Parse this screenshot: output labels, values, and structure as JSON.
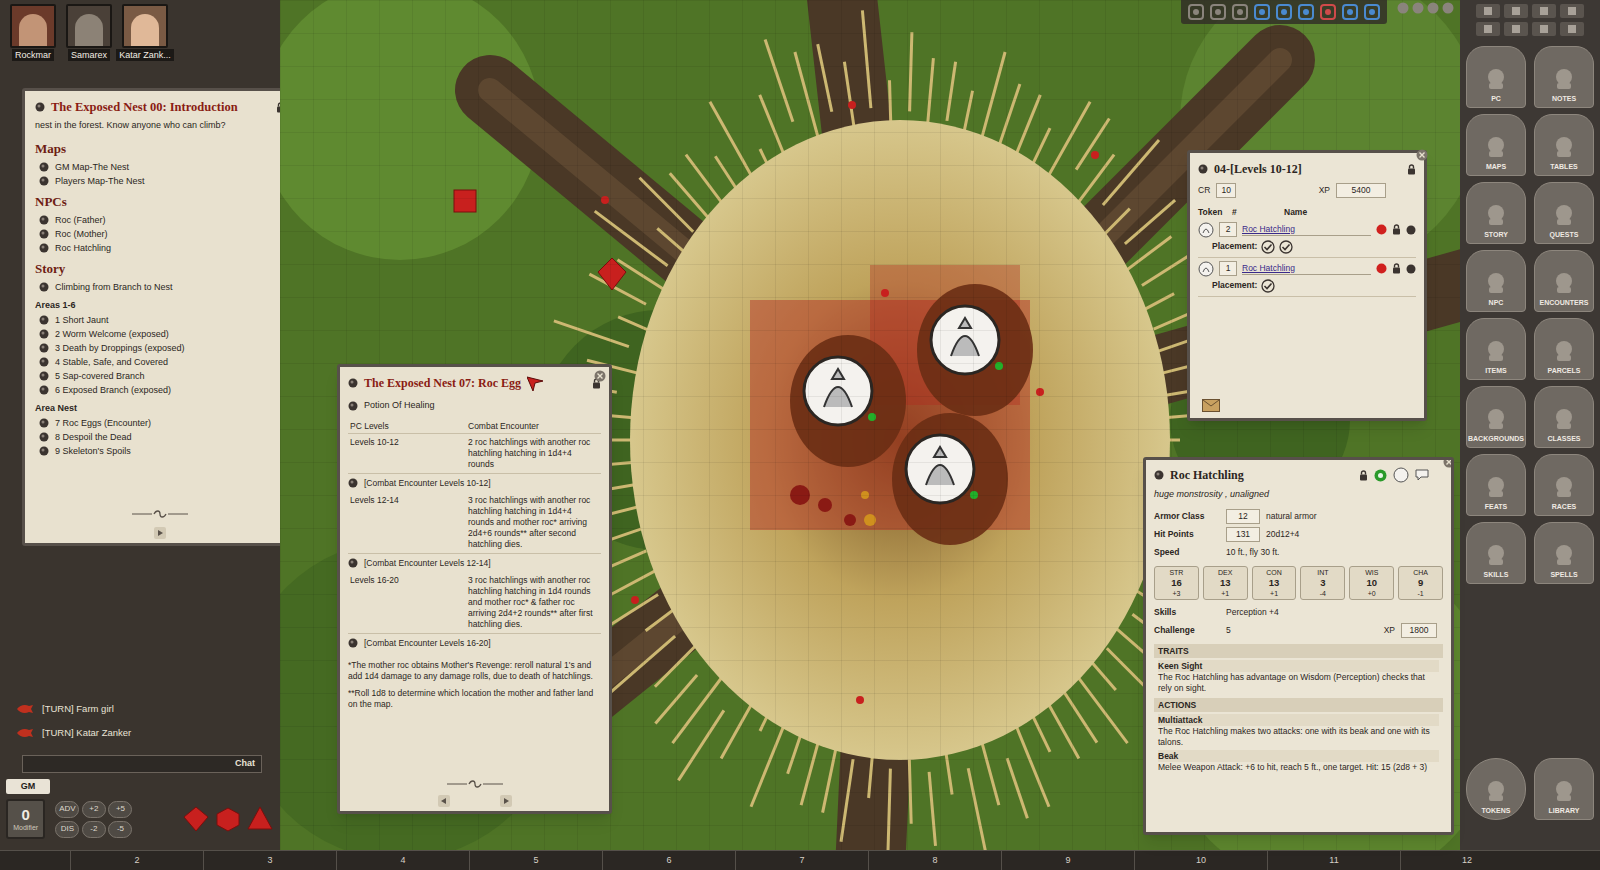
{
  "party": [
    {
      "name": "Rockmar"
    },
    {
      "name": "Samarex"
    },
    {
      "name": "Katar Zank..."
    }
  ],
  "story": {
    "title": "The Exposed Nest 00: Introduction",
    "intro": "nest in the forest. Know anyone who can climb?",
    "entries": [
      {
        "kind": "heading",
        "text": "Maps"
      },
      {
        "kind": "link",
        "text": "GM Map-The Nest"
      },
      {
        "kind": "link",
        "text": "Players Map-The Nest"
      },
      {
        "kind": "heading",
        "text": "NPCs"
      },
      {
        "kind": "link",
        "text": "Roc (Father)"
      },
      {
        "kind": "link",
        "text": "Roc (Mother)"
      },
      {
        "kind": "link",
        "text": "Roc Hatchling"
      },
      {
        "kind": "heading",
        "text": "Story"
      },
      {
        "kind": "link",
        "text": "Climbing from Branch to Nest"
      },
      {
        "kind": "subheading",
        "text": "Areas 1-6"
      },
      {
        "kind": "link",
        "text": "1 Short Jaunt"
      },
      {
        "kind": "link",
        "text": "2 Worm Welcome (exposed)"
      },
      {
        "kind": "link",
        "text": "3 Death by Droppings (exposed)"
      },
      {
        "kind": "link",
        "text": "4 Stable, Safe, and Covered"
      },
      {
        "kind": "link",
        "text": "5 Sap-covered Branch"
      },
      {
        "kind": "link",
        "text": "6 Exposed Branch (exposed)"
      },
      {
        "kind": "subheading",
        "text": "Area Nest"
      },
      {
        "kind": "link",
        "text": "7 Roc Eggs (Encounter)"
      },
      {
        "kind": "link",
        "text": "8 Despoil the Dead"
      },
      {
        "kind": "link",
        "text": "9 Skeleton's Spoils"
      }
    ]
  },
  "chat": {
    "messages": [
      {
        "text": "[TURN] Farm girl"
      },
      {
        "text": "[TURN] Katar Zanker"
      }
    ],
    "input_label": "Chat"
  },
  "identity": "GM",
  "modifier": {
    "value": "0",
    "label": "Modifier"
  },
  "modifier_buttons": [
    "ADV",
    "+2",
    "+5",
    "DIS",
    "-2",
    "-5"
  ],
  "notes": {
    "title": "The Exposed Nest 07: Roc Egg",
    "item": "Potion Of Healing",
    "columns": [
      "PC Levels",
      "Combat Encounter"
    ],
    "rows": [
      {
        "level": "Levels 10-12",
        "encounter": "2 roc hatchlings with another roc hatchling hatching in 1d4+4 rounds",
        "link": "[Combat Encounter Levels 10-12]"
      },
      {
        "level": "Levels 12-14",
        "encounter": "3 roc hatchlings with another roc hatchling hatching in 1d4+4 rounds and mother roc* arriving 2d4+6 rounds** after second hatchling dies.",
        "link": "[Combat Encounter Levels 12-14]"
      },
      {
        "level": "Levels 16-20",
        "encounter": "3 roc hatchlings with another roc hatchling hatching in 1d4 rounds and mother roc* & father roc arriving 2d4+2 rounds** after first hatchling dies.",
        "link": "[Combat Encounter Levels 16-20]"
      }
    ],
    "footnotes": [
      "*The mother roc obtains Mother's Revenge: reroll natural 1's and add 1d4 damage to any damage rolls, due to death of hatchlings.",
      "**Roll 1d8 to determine which location the mother and father land on the map."
    ]
  },
  "encounter": {
    "title": "04-[Levels 10-12]",
    "cr_label": "CR",
    "cr": "10",
    "xp_label": "XP",
    "xp": "5400",
    "columns": [
      "Token",
      "#",
      "Name"
    ],
    "rows": [
      {
        "count": "2",
        "name": "Roc Hatchling",
        "placement_label": "Placement:",
        "placements": [
          true,
          true
        ]
      },
      {
        "count": "1",
        "name": "Roc Hatchling",
        "placement_label": "Placement:",
        "placements": [
          true
        ]
      }
    ]
  },
  "npc": {
    "name": "Roc Hatchling",
    "type": "huge monstrosity , unaligned",
    "fields": [
      {
        "label": "Armor Class",
        "value": "12",
        "extra": "natural armor"
      },
      {
        "label": "Hit Points",
        "value": "131",
        "extra": "20d12+4"
      }
    ],
    "speed_label": "Speed",
    "speed": "10 ft., fly 30 ft.",
    "abilities": [
      {
        "label": "STR",
        "score": "16",
        "mod": "+3"
      },
      {
        "label": "DEX",
        "score": "13",
        "mod": "+1"
      },
      {
        "label": "CON",
        "score": "13",
        "mod": "+1"
      },
      {
        "label": "INT",
        "score": "3",
        "mod": "-4"
      },
      {
        "label": "WIS",
        "score": "10",
        "mod": "+0"
      },
      {
        "label": "CHA",
        "score": "9",
        "mod": "-1"
      }
    ],
    "skills_label": "Skills",
    "skills": "Perception +4",
    "challenge_label": "Challenge",
    "challenge": "5",
    "xp_label": "XP",
    "xp": "1800",
    "sections": [
      {
        "heading": "TRAITS",
        "entries": [
          {
            "name": "Keen Sight",
            "text": "The Roc Hatchling has advantage on Wisdom (Perception) checks that rely on sight."
          }
        ]
      },
      {
        "heading": "ACTIONS",
        "entries": [
          {
            "name": "Multiattack",
            "text": "The Roc Hatchling makes two attacks: one with its beak and one with its talons."
          },
          {
            "name": "Beak",
            "text": "Melee Weapon Attack: +6 to hit, reach 5 ft., one target. Hit: 15 (2d8 + 3)"
          }
        ]
      }
    ]
  },
  "sidebar": [
    {
      "label": "PC"
    },
    {
      "label": "NOTES"
    },
    {
      "label": "MAPS"
    },
    {
      "label": "TABLES"
    },
    {
      "label": "STORY"
    },
    {
      "label": "QUESTS"
    },
    {
      "label": "NPC"
    },
    {
      "label": "ENCOUNTERS"
    },
    {
      "label": "ITEMS"
    },
    {
      "label": "PARCELS"
    },
    {
      "label": "BACKGROUNDS"
    },
    {
      "label": "CLASSES"
    },
    {
      "label": "FEATS"
    },
    {
      "label": "RACES"
    },
    {
      "label": "SKILLS"
    },
    {
      "label": "SPELLS"
    }
  ],
  "sidebar_bottom": [
    {
      "label": "TOKENS"
    },
    {
      "label": "LIBRARY"
    }
  ],
  "ruler": [
    "2",
    "3",
    "4",
    "5",
    "6",
    "7",
    "8",
    "9",
    "10",
    "11",
    "12"
  ]
}
